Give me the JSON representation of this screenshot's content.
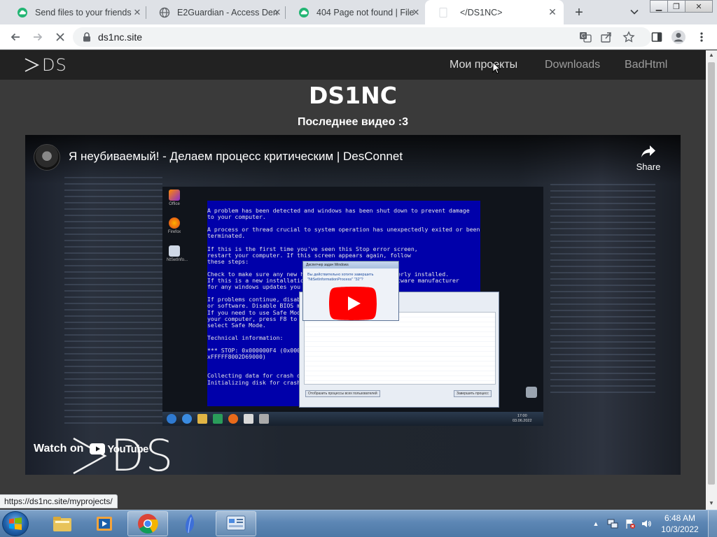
{
  "browser": {
    "tabs": [
      {
        "title": "Send files to your friends",
        "favicon": "cloud-icon",
        "color": "#22b573"
      },
      {
        "title": "E2Guardian - Access Den",
        "favicon": "globe-icon",
        "color": "#5f6368"
      },
      {
        "title": "404 Page not found | File",
        "favicon": "cloud-icon",
        "color": "#22b573"
      },
      {
        "title": "</DS1NC>",
        "favicon": "blank-page-icon",
        "color": "#ffffff"
      }
    ],
    "active_tab_index": 3,
    "new_tab_label": "+",
    "address": "ds1nc.site"
  },
  "site": {
    "logo_text": "DS",
    "nav": [
      {
        "label": "Мои проекты"
      },
      {
        "label": "Downloads"
      },
      {
        "label": "BadHtml"
      }
    ],
    "title": "DS1NC",
    "subtitle": "Последнее видео :3"
  },
  "video": {
    "title": "Я неубиваемый! - Делаем процесс критическим | DesConnet",
    "share_label": "Share",
    "watch_on_label": "Watch on",
    "youtube_label": "YouTube",
    "watermark_text": "DS",
    "bsod_text": "A problem has been detected and windows has been shut down to prevent damage\nto your computer.\n\nA process or thread crucial to system operation has unexpectedly exited or been\nterminated.\n\nIf this is the first time you've seen this Stop error screen,\nrestart your computer. If this screen appears again, follow\nthese steps:\n\nCheck to make sure any new hardware or software is properly installed.\nIf this is a new installation, ask your hardware or software manufacturer\nfor any windows updates you might need.\n\nIf problems continue, disable or remove any newly installed hardware\nor software. Disable BIOS memory options such as caching or shadowing.\nIf you need to use Safe Mode to remove or disable components, restart\nyour computer, press F8 to select Advanced Startup Options, and then\nselect Safe Mode.\n\nTechnical information:\n\n*** STOP: 0x000000F4 (0x00000000000000003,0xFFFFFA8002D69000,\nxFFFFF8002D69000)\n\n\nCollecting data for crash dump ...\nInitializing disk for crash dump ...",
    "dialog_title": "Диспетчер задач Windows",
    "dialog_text": "Вы действительно хотите завершить \"NtSetInformationProcess\" \"32\"?",
    "task_btn_left": "Отобразить процессы всех пользователей",
    "task_btn_right": "Завершить процесс",
    "inner_clock_time": "17:00",
    "inner_clock_date": "03.06.2022"
  },
  "status_url": "https://ds1nc.site/myprojects/",
  "taskbar": {
    "pinned": [
      {
        "name": "file-explorer"
      },
      {
        "name": "media-player"
      },
      {
        "name": "chrome",
        "open": true
      },
      {
        "name": "feather-app"
      },
      {
        "name": "control-panel",
        "open": true
      }
    ],
    "time": "6:48 AM",
    "date": "10/3/2022"
  }
}
